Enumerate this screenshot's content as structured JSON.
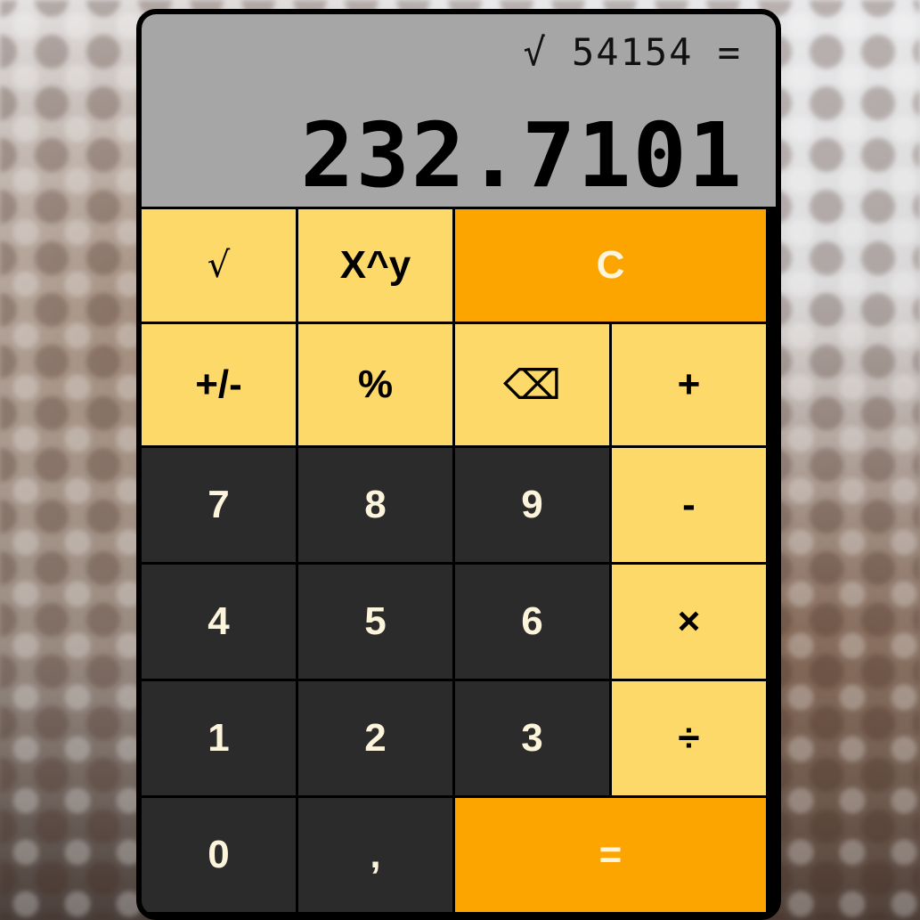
{
  "display": {
    "expression": "√ 54154 =",
    "result": "232.7101"
  },
  "keys": {
    "sqrt": "√",
    "power": "X^y",
    "clear": "C",
    "sign": "+/-",
    "percent": "%",
    "backspace": "⌫",
    "add": "+",
    "seven": "7",
    "eight": "8",
    "nine": "9",
    "subtract": "-",
    "four": "4",
    "five": "5",
    "six": "6",
    "multiply": "×",
    "one": "1",
    "two": "2",
    "three": "3",
    "divide": "÷",
    "zero": "0",
    "comma": ",",
    "equals": "="
  },
  "colors": {
    "function_key": "#fdd96a",
    "accent_key": "#fca500",
    "digit_key": "#2b2b2b",
    "frame": "#000000"
  }
}
